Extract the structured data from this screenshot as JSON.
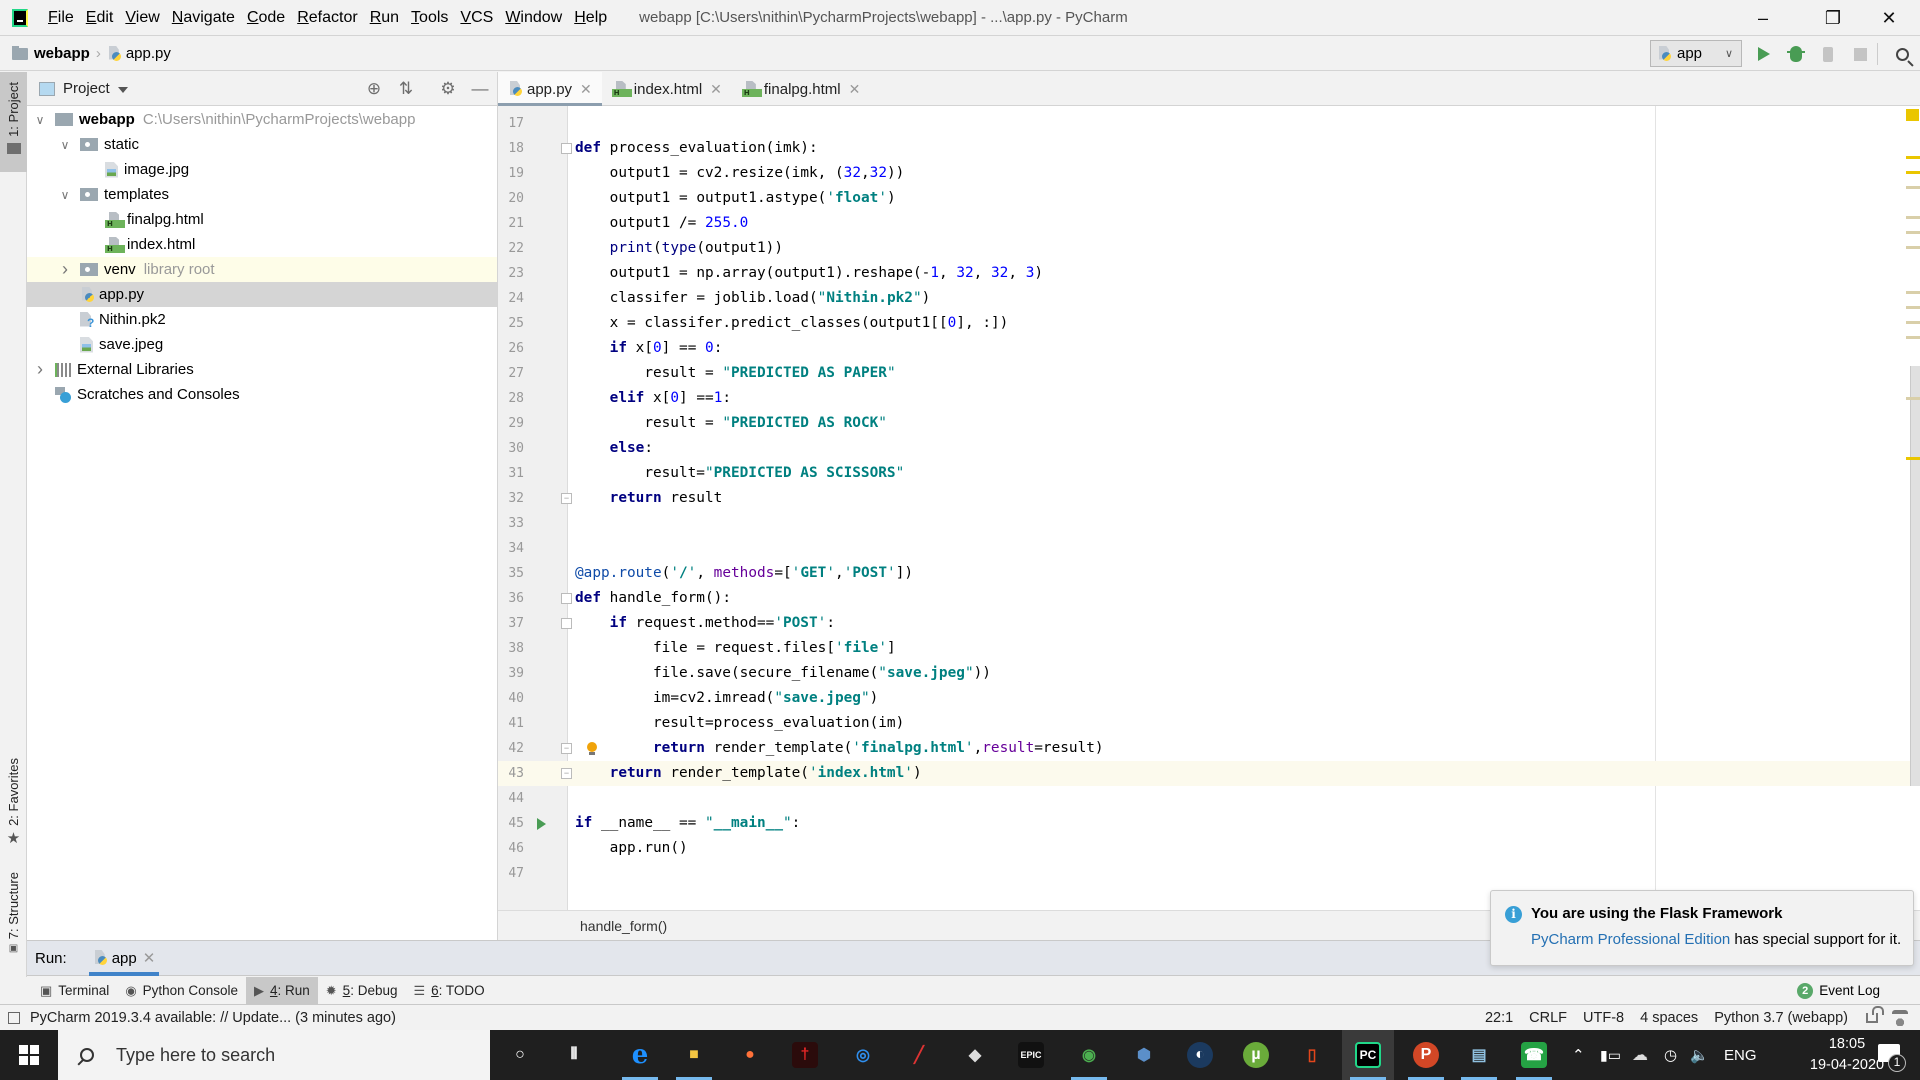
{
  "window": {
    "title": "webapp [C:\\Users\\nithin\\PycharmProjects\\webapp] - ...\\app.py - PyCharm",
    "controls": [
      "minimize",
      "restore",
      "close"
    ]
  },
  "menu": [
    {
      "label": "File",
      "mnemonic": "F",
      "rest": "ile"
    },
    {
      "label": "Edit",
      "mnemonic": "E",
      "rest": "dit"
    },
    {
      "label": "View",
      "mnemonic": "V",
      "rest": "iew"
    },
    {
      "label": "Navigate",
      "mnemonic": "N",
      "rest": "avigate"
    },
    {
      "label": "Code",
      "mnemonic": "C",
      "rest": "ode"
    },
    {
      "label": "Refactor",
      "mnemonic": "R",
      "rest": "efactor"
    },
    {
      "label": "Run",
      "mnemonic": "R",
      "rest": "un",
      "prefix": ""
    },
    {
      "label": "Tools",
      "mnemonic": "T",
      "rest": "ools"
    },
    {
      "label": "VCS",
      "mnemonic": "VC",
      "rest": "S"
    },
    {
      "label": "Window",
      "mnemonic": "W",
      "rest": "indow"
    },
    {
      "label": "Help",
      "mnemonic": "H",
      "rest": "elp"
    }
  ],
  "navbar": {
    "breadcrumb": [
      "webapp",
      "app.py"
    ],
    "run_config": "app",
    "actions": [
      "run-icon",
      "debug-icon",
      "coverage-icon",
      "stop-icon",
      "search-everywhere-icon"
    ]
  },
  "left_strip": {
    "tabs": [
      "1: Project",
      "2: Favorites",
      "7: Structure"
    ]
  },
  "project": {
    "title": "Project",
    "tree": [
      {
        "name": "webapp",
        "extra": "C:\\Users\\nithin\\PycharmProjects\\webapp",
        "type": "folder-root",
        "depth": 0,
        "expanded": true
      },
      {
        "name": "static",
        "type": "folder",
        "depth": 1,
        "expanded": true
      },
      {
        "name": "image.jpg",
        "type": "image",
        "depth": 2
      },
      {
        "name": "templates",
        "type": "folder",
        "depth": 1,
        "expanded": true
      },
      {
        "name": "finalpg.html",
        "type": "html",
        "depth": 2
      },
      {
        "name": "index.html",
        "type": "html",
        "depth": 2
      },
      {
        "name": "venv",
        "extra": "library root",
        "type": "folder",
        "depth": 1,
        "expanded": false
      },
      {
        "name": "app.py",
        "type": "python",
        "depth": 1,
        "selected": true
      },
      {
        "name": "Nithin.pk2",
        "type": "unknown",
        "depth": 1
      },
      {
        "name": "save.jpeg",
        "type": "image",
        "depth": 1
      },
      {
        "name": "External Libraries",
        "type": "libraries",
        "depth": 0,
        "expanded": false
      },
      {
        "name": "Scratches and Consoles",
        "type": "scratches",
        "depth": 0
      }
    ]
  },
  "editor": {
    "tabs": [
      {
        "label": "app.py",
        "active": true
      },
      {
        "label": "index.html",
        "active": false
      },
      {
        "label": "finalpg.html",
        "active": false
      }
    ],
    "first_line": 17,
    "caret_line": 43,
    "lines": [
      "",
      "def process_evaluation(imk):",
      "    output1 = cv2.resize(imk, (32,32))",
      "    output1 = output1.astype('float')",
      "    output1 /= 255.0",
      "    print(type(output1))",
      "    output1 = np.array(output1).reshape(-1, 32, 32, 3)",
      "    classifer = joblib.load(\"Nithin.pk2\")",
      "    x = classifer.predict_classes(output1[[0], :])",
      "    if x[0] == 0:",
      "        result = \"PREDICTED AS PAPER\"",
      "    elif x[0] ==1:",
      "        result = \"PREDICTED AS ROCK\"",
      "    else:",
      "        result=\"PREDICTED AS SCISSORS\"",
      "    return result",
      "",
      "",
      "@app.route('/', methods=['GET','POST'])",
      "def handle_form():",
      "    if request.method=='POST':",
      "         file = request.files['file']",
      "         file.save(secure_filename(\"save.jpeg\"))",
      "         im=cv2.imread(\"save.jpeg\")",
      "         result=process_evaluation(im)",
      "         return render_template('finalpg.html',result=result)",
      "    return render_template('index.html')",
      "",
      "if __name__ == \"__main__\":",
      "    app.run()",
      ""
    ],
    "breadcrumb": "handle_form()"
  },
  "run_panel": {
    "label": "Run:",
    "tab": "app"
  },
  "tool_windows": [
    {
      "label": "Terminal",
      "num": "",
      "icon": "terminal-icon"
    },
    {
      "label": "Python Console",
      "num": "",
      "icon": "python-console-icon"
    },
    {
      "label": ": Run",
      "num": "4",
      "icon": "run-icon",
      "active": true
    },
    {
      "label": ": Debug",
      "num": "5",
      "icon": "debug-icon"
    },
    {
      "label": ": TODO",
      "num": "6",
      "icon": "todo-icon"
    }
  ],
  "event_log": {
    "label": "Event Log",
    "count": "2"
  },
  "status": {
    "message": "PyCharm 2019.3.4 available: // Update... (3 minutes ago)",
    "position": "22:1",
    "line_sep": "CRLF",
    "encoding": "UTF-8",
    "indent": "4 spaces",
    "interpreter": "Python 3.7 (webapp)"
  },
  "notification": {
    "title": "You are using the Flask Framework",
    "link": "PyCharm Professional Edition",
    "body": " has special support for it."
  },
  "taskbar": {
    "search_placeholder": "Type here to search",
    "apps": [
      "cortana",
      "task-view",
      "edge",
      "file-explorer",
      "firefox",
      "acrobat",
      "uplay",
      "app-striped",
      "unity",
      "epic-games",
      "chrome",
      "virtualbox",
      "steam",
      "utorrent",
      "office",
      "pycharm",
      "powerpoint",
      "notepad",
      "whatsapp"
    ],
    "language": "ENG",
    "time": "18:05",
    "date": "19-04-2020",
    "notifications": "1"
  }
}
